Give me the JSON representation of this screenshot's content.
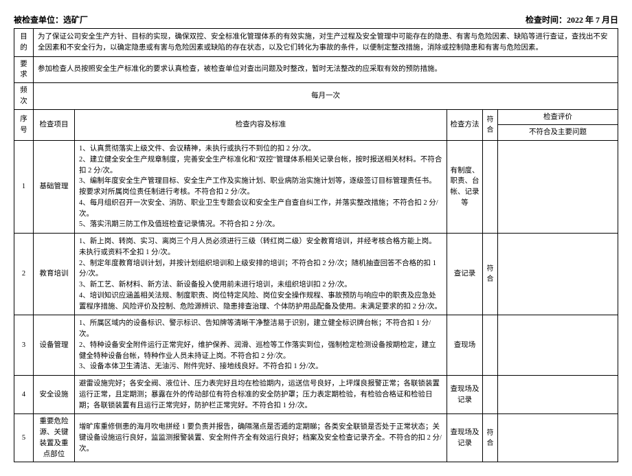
{
  "header": {
    "unit_label": "被检查单位：选矿厂",
    "time_label": "检查时间：2022 年 7 月日"
  },
  "rows": {
    "purpose_label": "目的",
    "purpose_text": "为了保证公司安全生产方针、目标的实现，确保双控、安全标准化管理体系的有效实施，对生产过程及安全管理中可能存在的隐患、有害与危险因素、缺陷等进行查证，查找出不安全因素和不安全行为，以确定隐患或有害与危险因素或缺陷的存在状态，以及它们转化为事故的条件，以便制定整改措施，消除或控制隐患和有害与危险因素。",
    "require_label": "要求",
    "require_text": "参加检查人员按照安全生产标准化的要求认真检查，被检查单位对查出问题及时整改，暂时无法整改的应采取有效的预防措施。",
    "freq_label": "频次",
    "freq_text": "每月一次",
    "seq_label": "序号",
    "item_label": "检查项目",
    "content_label": "检查内容及标准",
    "method_label": "检查方法",
    "fuhe_label": "符合",
    "eval_label": "检查评价",
    "eval_sub_label": "不符合及主要问题"
  },
  "items": [
    {
      "seq": "1",
      "name": "基础管理",
      "content": "1、认真贯彻落实上级文件、会议精神，未执行或执行不到位的扣 2 分/次。\n2、建立健全安全生产规章制度，完善安全生产标准化和\"双控\"管理体系相关记录台帐，按时报送相关材料。不符合扣 2 分/次。\n3、编制年度安全生产管理目标、安全生产工作及实施计划、职业病防治实施计划等，逐级签订目标管理责任书。按要求对所属岗位责任制进行考核。不符合扣 2 分/次。\n4、每月组织召开一次安全、消防、职业卫生专题会议和安全生产自查自纠工作，并落实整改措施；不符合扣 2 分/次。\n5、落实汛期三防工作及值班检查记录情况。不符合扣 2 分/次。",
      "method": "有制度、职责、台帐、记录等",
      "fuhe": "",
      "eval": ""
    },
    {
      "seq": "2",
      "name": "教育培训",
      "content": "1、新上岗、转岗、实习、离岗三个月人员必须进行三级（转红岗二级）安全教育培训，并经考核合格方能上岗。未执行或资料不全扣 1 分/次。\n2、制定年度教育培训计划，并按计划组织培训和上级安排的培训；不符合扣 2 分/次；随机抽查回答不合格的扣 1 分/次。\n3、新工艺、新材料、新方法、新设备投入使用前未进行培训，未组织培训扣 2 分/次。\n4、培训知识应涵盖相关法规、制度职责、岗位特定风险、岗位安全操作规程、事故预防与响应中的职责及应急处置程序措施、风险评价及控制、危险源辨识、隐患排查治理、个体防护用品配备及使用。未满足要求的扣 2 分/次。",
      "method": "查记录",
      "fuhe": "符合",
      "eval": ""
    },
    {
      "seq": "3",
      "name": "设备管理",
      "content": "1、所属区域内的设备标识、警示标识、告知牌等清晰干净整洁易于识别，建立健全标识牌台帐；不符合扣 1 分/次。\n2、特种设备安全附件运行正常完好，维护保养、润滑、巡检等工作落实到位，强制检定检测设备按期检定，建立健全特种设备台帐，特种作业人员未持证上岗。不符合扣 2 分/次。\n3、设备本体卫生清洁、无油污、附件完好、接地线良好。不符合扣 1 分/次。",
      "method": "查现场",
      "fuhe": "",
      "eval": ""
    },
    {
      "seq": "4",
      "name": "安全设施",
      "content": "避雷设施完好；各安全阀、液位计、压力表完好且均在检验期内，运送信号良好，上坪煤良报警正常；各联锁装置运行正常，且定期测；暴露在外的传动部位有符合标准的安全防护罩；压力表定期检验，有检验合格证和检验日期；各联锁装置有且运行正常完好，防护栏正常完好。不符合扣 1 分/次。",
      "method": "查现场及记录",
      "fuhe": "",
      "eval": ""
    },
    {
      "seq": "5",
      "name": "重要危险源、关键装置及重点部位",
      "content": "增旷库重修侧患的海月吹电拼经 1 要负责并报告，确隔潴点是否遁的定期睇；各类安全联锁是否处于正常状态；关键设备设施运行良好，监监测报警装置、安全附件齐全有效运行良好；档案及安全检查记录齐全。不符合的扣 2 分/次。",
      "method": "查现场及记录",
      "fuhe": "符合",
      "eval": ""
    }
  ]
}
